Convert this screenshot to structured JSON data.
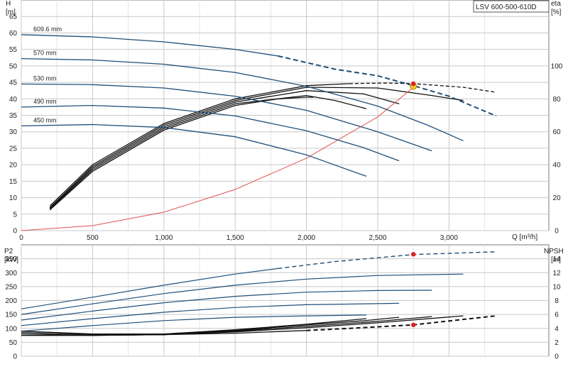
{
  "model_label": "LSV 600-500-610D",
  "colors": {
    "curve": "#1f4e79",
    "system": "#e05050",
    "eff": "#111111",
    "grid": "#c8c8c8",
    "dot_yellow": "#f4c430",
    "dot_red": "#e02020"
  },
  "chart_data": [
    {
      "type": "line",
      "id": "head-efficiency",
      "xlabel": "Q [m³/h]",
      "ylabel": "H",
      "yunit": "[m]",
      "y2label": "eta",
      "y2unit": "[%]",
      "xlim": [
        0,
        3700
      ],
      "ylim": [
        0,
        70
      ],
      "y2lim": [
        0,
        140
      ],
      "x_ticks": [
        0,
        500,
        1000,
        1500,
        2000,
        2500,
        3000
      ],
      "x_tick_labels": [
        "0",
        "500",
        "1,000",
        "1,500",
        "2,000",
        "2,500",
        "3,000"
      ],
      "y_ticks": [
        0,
        5,
        10,
        15,
        20,
        25,
        30,
        35,
        40,
        45,
        50,
        55,
        60,
        65
      ],
      "y2_ticks": [
        0,
        20,
        40,
        60,
        80,
        100
      ],
      "grid": true,
      "head_series": [
        {
          "name": "609.6 mm",
          "x": [
            0,
            500,
            1000,
            1500,
            1800
          ],
          "y": [
            59.5,
            58.8,
            57.3,
            55.0,
            53.0
          ],
          "dashed_x": [
            1800,
            2200,
            2500,
            2750,
            3000,
            3330
          ],
          "dashed_y": [
            53.0,
            49.0,
            47.0,
            44.0,
            40.8,
            34.8
          ]
        },
        {
          "name": "570 mm",
          "x": [
            0,
            500,
            1000,
            1500,
            2000,
            2500,
            2850,
            3100
          ],
          "y": [
            52.2,
            51.8,
            50.5,
            48.0,
            43.8,
            37.8,
            32.0,
            27.3
          ]
        },
        {
          "name": "530 mm",
          "x": [
            0,
            500,
            1000,
            1500,
            2000,
            2500,
            2880
          ],
          "y": [
            44.5,
            44.3,
            43.3,
            40.8,
            36.5,
            30.0,
            24.2
          ]
        },
        {
          "name": "490 mm",
          "x": [
            0,
            500,
            1000,
            1500,
            2000,
            2400,
            2650
          ],
          "y": [
            37.5,
            38.0,
            37.2,
            34.8,
            30.3,
            25.2,
            21.2
          ]
        },
        {
          "name": "450 mm",
          "x": [
            0,
            500,
            1000,
            1500,
            2000,
            2420
          ],
          "y": [
            31.8,
            32.2,
            31.3,
            28.5,
            23.0,
            16.5
          ]
        }
      ],
      "system_curve": {
        "x": [
          0,
          500,
          1000,
          1500,
          2000,
          2500,
          2750
        ],
        "y": [
          0,
          1.5,
          5.6,
          12.5,
          22.0,
          34.5,
          43.5
        ]
      },
      "duty_point": {
        "x": 2750,
        "y": 43.8
      },
      "efficiency_series": [
        {
          "x": [
            200,
            500,
            1000,
            1500,
            2000,
            2300,
            2550,
            2750,
            3100,
            3330
          ],
          "y": [
            7.5,
            20.0,
            32.5,
            40.0,
            44.0,
            44.6,
            44.8,
            44.6,
            43.5,
            42.0
          ],
          "dashed_from": 2300
        },
        {
          "x": [
            200,
            500,
            1000,
            1500,
            2000,
            2500,
            2880,
            3100
          ],
          "y": [
            7.0,
            19.5,
            32.0,
            39.5,
            43.5,
            43.3,
            41.0,
            39.5
          ]
        },
        {
          "x": [
            200,
            500,
            1000,
            1500,
            2000,
            2400,
            2650
          ],
          "y": [
            6.8,
            19.0,
            31.5,
            39.0,
            42.5,
            41.5,
            38.5
          ]
        },
        {
          "x": [
            200,
            500,
            1000,
            1500,
            2000,
            2200,
            2420
          ],
          "y": [
            6.5,
            18.5,
            31.0,
            38.5,
            41.0,
            39.5,
            37.0
          ]
        },
        {
          "x": [
            200,
            500,
            1000,
            1500,
            1800,
            2000,
            2050
          ],
          "y": [
            6.3,
            18.0,
            30.5,
            38.0,
            40.0,
            40.5,
            40.5
          ]
        }
      ],
      "eff_point": {
        "x": 2750,
        "y": 44.6
      }
    },
    {
      "type": "line",
      "id": "power-npsh",
      "ylabel": "P2",
      "yunit": "[kW]",
      "y2label": "NPSH",
      "y2unit": "[m]",
      "xlim": [
        0,
        3700
      ],
      "ylim": [
        0,
        400
      ],
      "y2lim": [
        0,
        16
      ],
      "y_ticks": [
        0,
        50,
        100,
        150,
        200,
        250,
        300,
        350
      ],
      "y2_ticks": [
        0,
        2,
        4,
        6,
        8,
        10,
        12,
        14
      ],
      "grid": true,
      "power_series": [
        {
          "name": "609.6 mm",
          "x": [
            0,
            500,
            1000,
            1500,
            1800
          ],
          "y": [
            170,
            212,
            255,
            295,
            315
          ],
          "dashed_x": [
            1800,
            2200,
            2750,
            3330
          ],
          "dashed_y": [
            315,
            340,
            365,
            375
          ]
        },
        {
          "name": "570 mm",
          "x": [
            0,
            500,
            1000,
            1500,
            2000,
            2500,
            3100
          ],
          "y": [
            150,
            188,
            225,
            255,
            277,
            290,
            295
          ]
        },
        {
          "name": "530 mm",
          "x": [
            0,
            500,
            1000,
            1500,
            2000,
            2500,
            2880
          ],
          "y": [
            130,
            162,
            192,
            215,
            230,
            236,
            237
          ]
        },
        {
          "name": "490 mm",
          "x": [
            0,
            500,
            1000,
            1500,
            2000,
            2650
          ],
          "y": [
            110,
            135,
            158,
            175,
            185,
            190
          ]
        },
        {
          "name": "450 mm",
          "x": [
            0,
            500,
            1000,
            1500,
            2000,
            2420
          ],
          "y": [
            90,
            110,
            128,
            140,
            145,
            148
          ]
        }
      ],
      "power_point": {
        "x": 2750,
        "y": 366
      },
      "npsh_series": [
        {
          "x": [
            0,
            500,
            1000,
            1500,
            2000,
            2300,
            2750,
            3330
          ],
          "y": [
            3.0,
            3.0,
            3.1,
            3.3,
            3.7,
            4.0,
            4.5,
            5.8
          ],
          "dashed_from": 2000
        },
        {
          "x": [
            0,
            500,
            1000,
            1500,
            2000,
            2500,
            3100
          ],
          "y": [
            3.0,
            3.0,
            3.1,
            3.5,
            4.1,
            4.8,
            5.8
          ]
        },
        {
          "x": [
            0,
            500,
            1000,
            1500,
            2000,
            2500,
            2880
          ],
          "y": [
            3.2,
            3.0,
            3.1,
            3.6,
            4.3,
            5.0,
            5.7
          ]
        },
        {
          "x": [
            0,
            500,
            1000,
            1500,
            2000,
            2400,
            2650
          ],
          "y": [
            3.4,
            3.1,
            3.1,
            3.7,
            4.5,
            5.1,
            5.6
          ]
        },
        {
          "x": [
            0,
            500,
            1000,
            1500,
            2000,
            2420
          ],
          "y": [
            3.6,
            3.2,
            3.2,
            3.8,
            4.6,
            5.4
          ]
        }
      ],
      "npsh_point": {
        "x": 2750,
        "y": 4.5
      }
    }
  ]
}
